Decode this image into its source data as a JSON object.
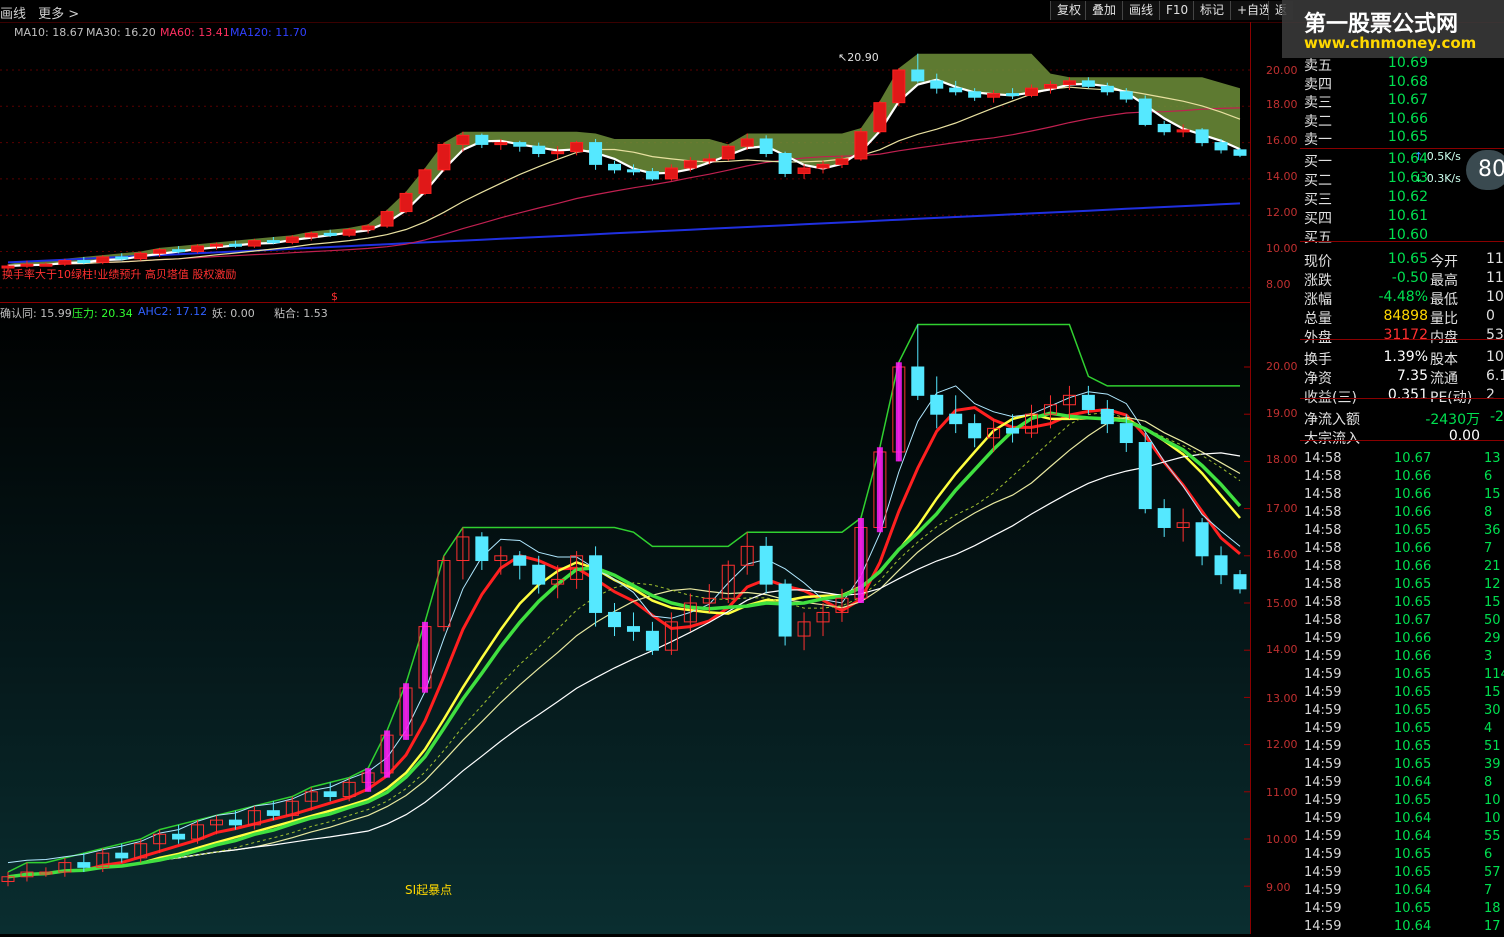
{
  "toolbar": {
    "left_items": [
      "画线",
      "更多 >"
    ],
    "buttons": [
      "复权",
      "叠加",
      "画线",
      "F10",
      "标记",
      "+自选",
      "返"
    ]
  },
  "logo": {
    "title": "第一股票公式网",
    "url": "www.chnmoney.com"
  },
  "ma_legend": [
    {
      "label": "MA10: 18.67",
      "color": "#e0e0e0"
    },
    {
      "label": "MA30: 16.20",
      "color": "#e0e0e0"
    },
    {
      "label": "MA60: 13.41",
      "color": "#ff3060"
    },
    {
      "label": "MA120: 11.70",
      "color": "#3040ff"
    }
  ],
  "upper_axis": [
    "20.00",
    "18.00",
    "16.00",
    "14.00",
    "12.00",
    "10.00",
    "8.00"
  ],
  "upper_peak_label": "20.90",
  "upper_tags": "换手率大于10绿柱!业绩预升 高贝塔值 股权激励",
  "upper_marker": "$",
  "indicator_legend": [
    {
      "label": "确认同: 15.99",
      "color": "#e0e0e0"
    },
    {
      "label": "压力: 20.34",
      "color": "#30ff30"
    },
    {
      "label": "AHC2: 17.12",
      "color": "#3060ff"
    },
    {
      "label": "妖: 0.00",
      "color": "#e0e0e0"
    },
    {
      "label": "粘合: 1.53",
      "color": "#e0e0e0"
    }
  ],
  "lower_axis": [
    "20.00",
    "19.00",
    "18.00",
    "17.00",
    "16.00",
    "15.00",
    "14.00",
    "13.00",
    "12.00",
    "11.00",
    "10.00",
    "9.00"
  ],
  "lower_note": "SI起暴点",
  "order_book": {
    "asks": [
      {
        "label": "卖五",
        "price": "10.69"
      },
      {
        "label": "卖四",
        "price": "10.68"
      },
      {
        "label": "卖三",
        "price": "10.67"
      },
      {
        "label": "卖二",
        "price": "10.66"
      },
      {
        "label": "卖一",
        "price": "10.65"
      }
    ],
    "bids": [
      {
        "label": "买一",
        "price": "10.64"
      },
      {
        "label": "买二",
        "price": "10.63"
      },
      {
        "label": "买三",
        "price": "10.62"
      },
      {
        "label": "买四",
        "price": "10.61"
      },
      {
        "label": "买五",
        "price": "10.60"
      }
    ]
  },
  "speed_badges": [
    {
      "label": "0.5K/s",
      "dir": "↑"
    },
    {
      "label": "0.3K/s",
      "dir": "↓"
    }
  ],
  "speed_circle": "80",
  "quote": [
    {
      "k": "现价",
      "v": "10.65",
      "vc": "#00e050",
      "k2": "今开",
      "v2": "11"
    },
    {
      "k": "涨跌",
      "v": "-0.50",
      "vc": "#00e050",
      "k2": "最高",
      "v2": "11"
    },
    {
      "k": "涨幅",
      "v": "-4.48%",
      "vc": "#00e050",
      "k2": "最低",
      "v2": "10"
    },
    {
      "k": "总量",
      "v": "84898",
      "vc": "#ffd800",
      "k2": "量比",
      "v2": "0"
    },
    {
      "k": "外盘",
      "v": "31172",
      "vc": "#ff3030",
      "k2": "内盘",
      "v2": "53"
    }
  ],
  "fundamentals": [
    {
      "k": "换手",
      "v": "1.39%",
      "k2": "股本",
      "v2": "10."
    },
    {
      "k": "净资",
      "v": "7.35",
      "k2": "流通",
      "v2": "6.1"
    },
    {
      "k": "收益(三)",
      "v": "0.351",
      "k2": "PE(动)",
      "v2": "2"
    }
  ],
  "flows": [
    {
      "k": "净流入额",
      "v": "-2430万",
      "v2": "-2",
      "vc": "#00e050"
    },
    {
      "k": "大宗流入",
      "v": "0.00",
      "v2": "",
      "vc": "#ffffff"
    }
  ],
  "trades": [
    {
      "t": "14:58",
      "p": "10.67",
      "q": "13"
    },
    {
      "t": "14:58",
      "p": "10.66",
      "q": "6"
    },
    {
      "t": "14:58",
      "p": "10.66",
      "q": "15"
    },
    {
      "t": "14:58",
      "p": "10.66",
      "q": "8"
    },
    {
      "t": "14:58",
      "p": "10.65",
      "q": "36"
    },
    {
      "t": "14:58",
      "p": "10.66",
      "q": "7"
    },
    {
      "t": "14:58",
      "p": "10.66",
      "q": "21"
    },
    {
      "t": "14:58",
      "p": "10.65",
      "q": "12"
    },
    {
      "t": "14:58",
      "p": "10.65",
      "q": "15"
    },
    {
      "t": "14:58",
      "p": "10.67",
      "q": "50"
    },
    {
      "t": "14:59",
      "p": "10.66",
      "q": "29"
    },
    {
      "t": "14:59",
      "p": "10.66",
      "q": "3"
    },
    {
      "t": "14:59",
      "p": "10.65",
      "q": "114"
    },
    {
      "t": "14:59",
      "p": "10.65",
      "q": "15"
    },
    {
      "t": "14:59",
      "p": "10.65",
      "q": "30"
    },
    {
      "t": "14:59",
      "p": "10.65",
      "q": "4"
    },
    {
      "t": "14:59",
      "p": "10.65",
      "q": "51"
    },
    {
      "t": "14:59",
      "p": "10.65",
      "q": "39"
    },
    {
      "t": "14:59",
      "p": "10.64",
      "q": "8"
    },
    {
      "t": "14:59",
      "p": "10.65",
      "q": "10"
    },
    {
      "t": "14:59",
      "p": "10.64",
      "q": "10"
    },
    {
      "t": "14:59",
      "p": "10.64",
      "q": "55"
    },
    {
      "t": "14:59",
      "p": "10.65",
      "q": "6"
    },
    {
      "t": "14:59",
      "p": "10.65",
      "q": "57"
    },
    {
      "t": "14:59",
      "p": "10.64",
      "q": "7"
    },
    {
      "t": "14:59",
      "p": "10.65",
      "q": "18"
    },
    {
      "t": "14:59",
      "p": "10.64",
      "q": "17"
    }
  ],
  "chart_data": [
    {
      "type": "candlestick",
      "panel": "upper",
      "ylim": [
        7.5,
        21.5
      ],
      "ohlc": [
        [
          9.1,
          9.3,
          9.0,
          9.2
        ],
        [
          9.2,
          9.5,
          9.1,
          9.3
        ],
        [
          9.3,
          9.4,
          9.2,
          9.3
        ],
        [
          9.3,
          9.6,
          9.2,
          9.5
        ],
        [
          9.5,
          9.7,
          9.3,
          9.4
        ],
        [
          9.4,
          9.8,
          9.3,
          9.7
        ],
        [
          9.7,
          9.9,
          9.5,
          9.6
        ],
        [
          9.6,
          10.0,
          9.5,
          9.9
        ],
        [
          9.9,
          10.2,
          9.7,
          10.1
        ],
        [
          10.1,
          10.3,
          9.9,
          10.0
        ],
        [
          10.0,
          10.4,
          9.9,
          10.3
        ],
        [
          10.3,
          10.5,
          10.1,
          10.4
        ],
        [
          10.4,
          10.6,
          10.2,
          10.3
        ],
        [
          10.3,
          10.7,
          10.2,
          10.6
        ],
        [
          10.6,
          10.8,
          10.4,
          10.5
        ],
        [
          10.5,
          10.9,
          10.4,
          10.8
        ],
        [
          10.8,
          11.1,
          10.6,
          11.0
        ],
        [
          11.0,
          11.2,
          10.8,
          10.9
        ],
        [
          10.9,
          11.3,
          10.8,
          11.2
        ],
        [
          11.2,
          11.5,
          11.0,
          11.4
        ],
        [
          11.4,
          12.3,
          11.3,
          12.2
        ],
        [
          12.2,
          13.3,
          12.1,
          13.2
        ],
        [
          13.2,
          14.6,
          13.1,
          14.5
        ],
        [
          14.5,
          16.0,
          14.4,
          15.9
        ],
        [
          15.9,
          16.6,
          15.5,
          16.4
        ],
        [
          16.4,
          16.5,
          15.7,
          15.9
        ],
        [
          15.9,
          16.2,
          15.6,
          16.0
        ],
        [
          16.0,
          16.1,
          15.5,
          15.8
        ],
        [
          15.8,
          16.0,
          15.2,
          15.4
        ],
        [
          15.4,
          15.8,
          15.1,
          15.5
        ],
        [
          15.5,
          16.1,
          15.3,
          16.0
        ],
        [
          16.0,
          16.2,
          14.5,
          14.8
        ],
        [
          14.8,
          15.0,
          14.3,
          14.5
        ],
        [
          14.5,
          14.8,
          14.2,
          14.4
        ],
        [
          14.4,
          14.6,
          13.9,
          14.0
        ],
        [
          14.0,
          14.8,
          13.9,
          14.6
        ],
        [
          14.6,
          15.2,
          14.4,
          15.0
        ],
        [
          15.0,
          15.4,
          14.8,
          15.1
        ],
        [
          15.1,
          15.9,
          15.0,
          15.8
        ],
        [
          15.8,
          16.5,
          15.6,
          16.2
        ],
        [
          16.2,
          16.4,
          15.2,
          15.4
        ],
        [
          15.4,
          15.5,
          14.1,
          14.3
        ],
        [
          14.3,
          14.8,
          14.0,
          14.6
        ],
        [
          14.6,
          15.0,
          14.3,
          14.8
        ],
        [
          14.8,
          15.3,
          14.6,
          15.1
        ],
        [
          15.1,
          16.8,
          15.0,
          16.6
        ],
        [
          16.6,
          18.3,
          16.5,
          18.2
        ],
        [
          18.2,
          20.1,
          18.0,
          20.0
        ],
        [
          20.0,
          20.9,
          19.3,
          19.4
        ],
        [
          19.4,
          19.8,
          18.7,
          19.0
        ],
        [
          19.0,
          19.4,
          18.6,
          18.8
        ],
        [
          18.8,
          19.0,
          18.3,
          18.5
        ],
        [
          18.5,
          18.9,
          18.2,
          18.7
        ],
        [
          18.7,
          19.0,
          18.4,
          18.6
        ],
        [
          18.6,
          19.2,
          18.5,
          19.0
        ],
        [
          19.0,
          19.4,
          18.7,
          19.2
        ],
        [
          19.2,
          19.6,
          18.9,
          19.4
        ],
        [
          19.4,
          19.6,
          19.0,
          19.1
        ],
        [
          19.1,
          19.3,
          18.6,
          18.8
        ],
        [
          18.8,
          19.0,
          18.2,
          18.4
        ],
        [
          18.4,
          18.6,
          16.9,
          17.0
        ],
        [
          17.0,
          17.2,
          16.4,
          16.6
        ],
        [
          16.6,
          17.0,
          16.3,
          16.7
        ],
        [
          16.7,
          16.8,
          15.8,
          16.0
        ],
        [
          16.0,
          16.2,
          15.4,
          15.6
        ],
        [
          15.6,
          15.7,
          15.2,
          15.3
        ]
      ],
      "ma": [
        {
          "name": "MA10",
          "color": "#ffffff"
        },
        {
          "name": "MA30",
          "color": "#e8e0a0"
        },
        {
          "name": "MA60",
          "color": "#c02050"
        },
        {
          "name": "MA120",
          "color": "#2030e0"
        }
      ]
    },
    {
      "type": "candlestick",
      "panel": "lower",
      "ylim": [
        8.8,
        20.7
      ],
      "series": [
        {
          "name": "压力",
          "color": "#30ff30"
        },
        {
          "name": "确认同",
          "color": "#ffffff"
        },
        {
          "name": "AHC2",
          "color": "#ff2020"
        }
      ]
    }
  ]
}
